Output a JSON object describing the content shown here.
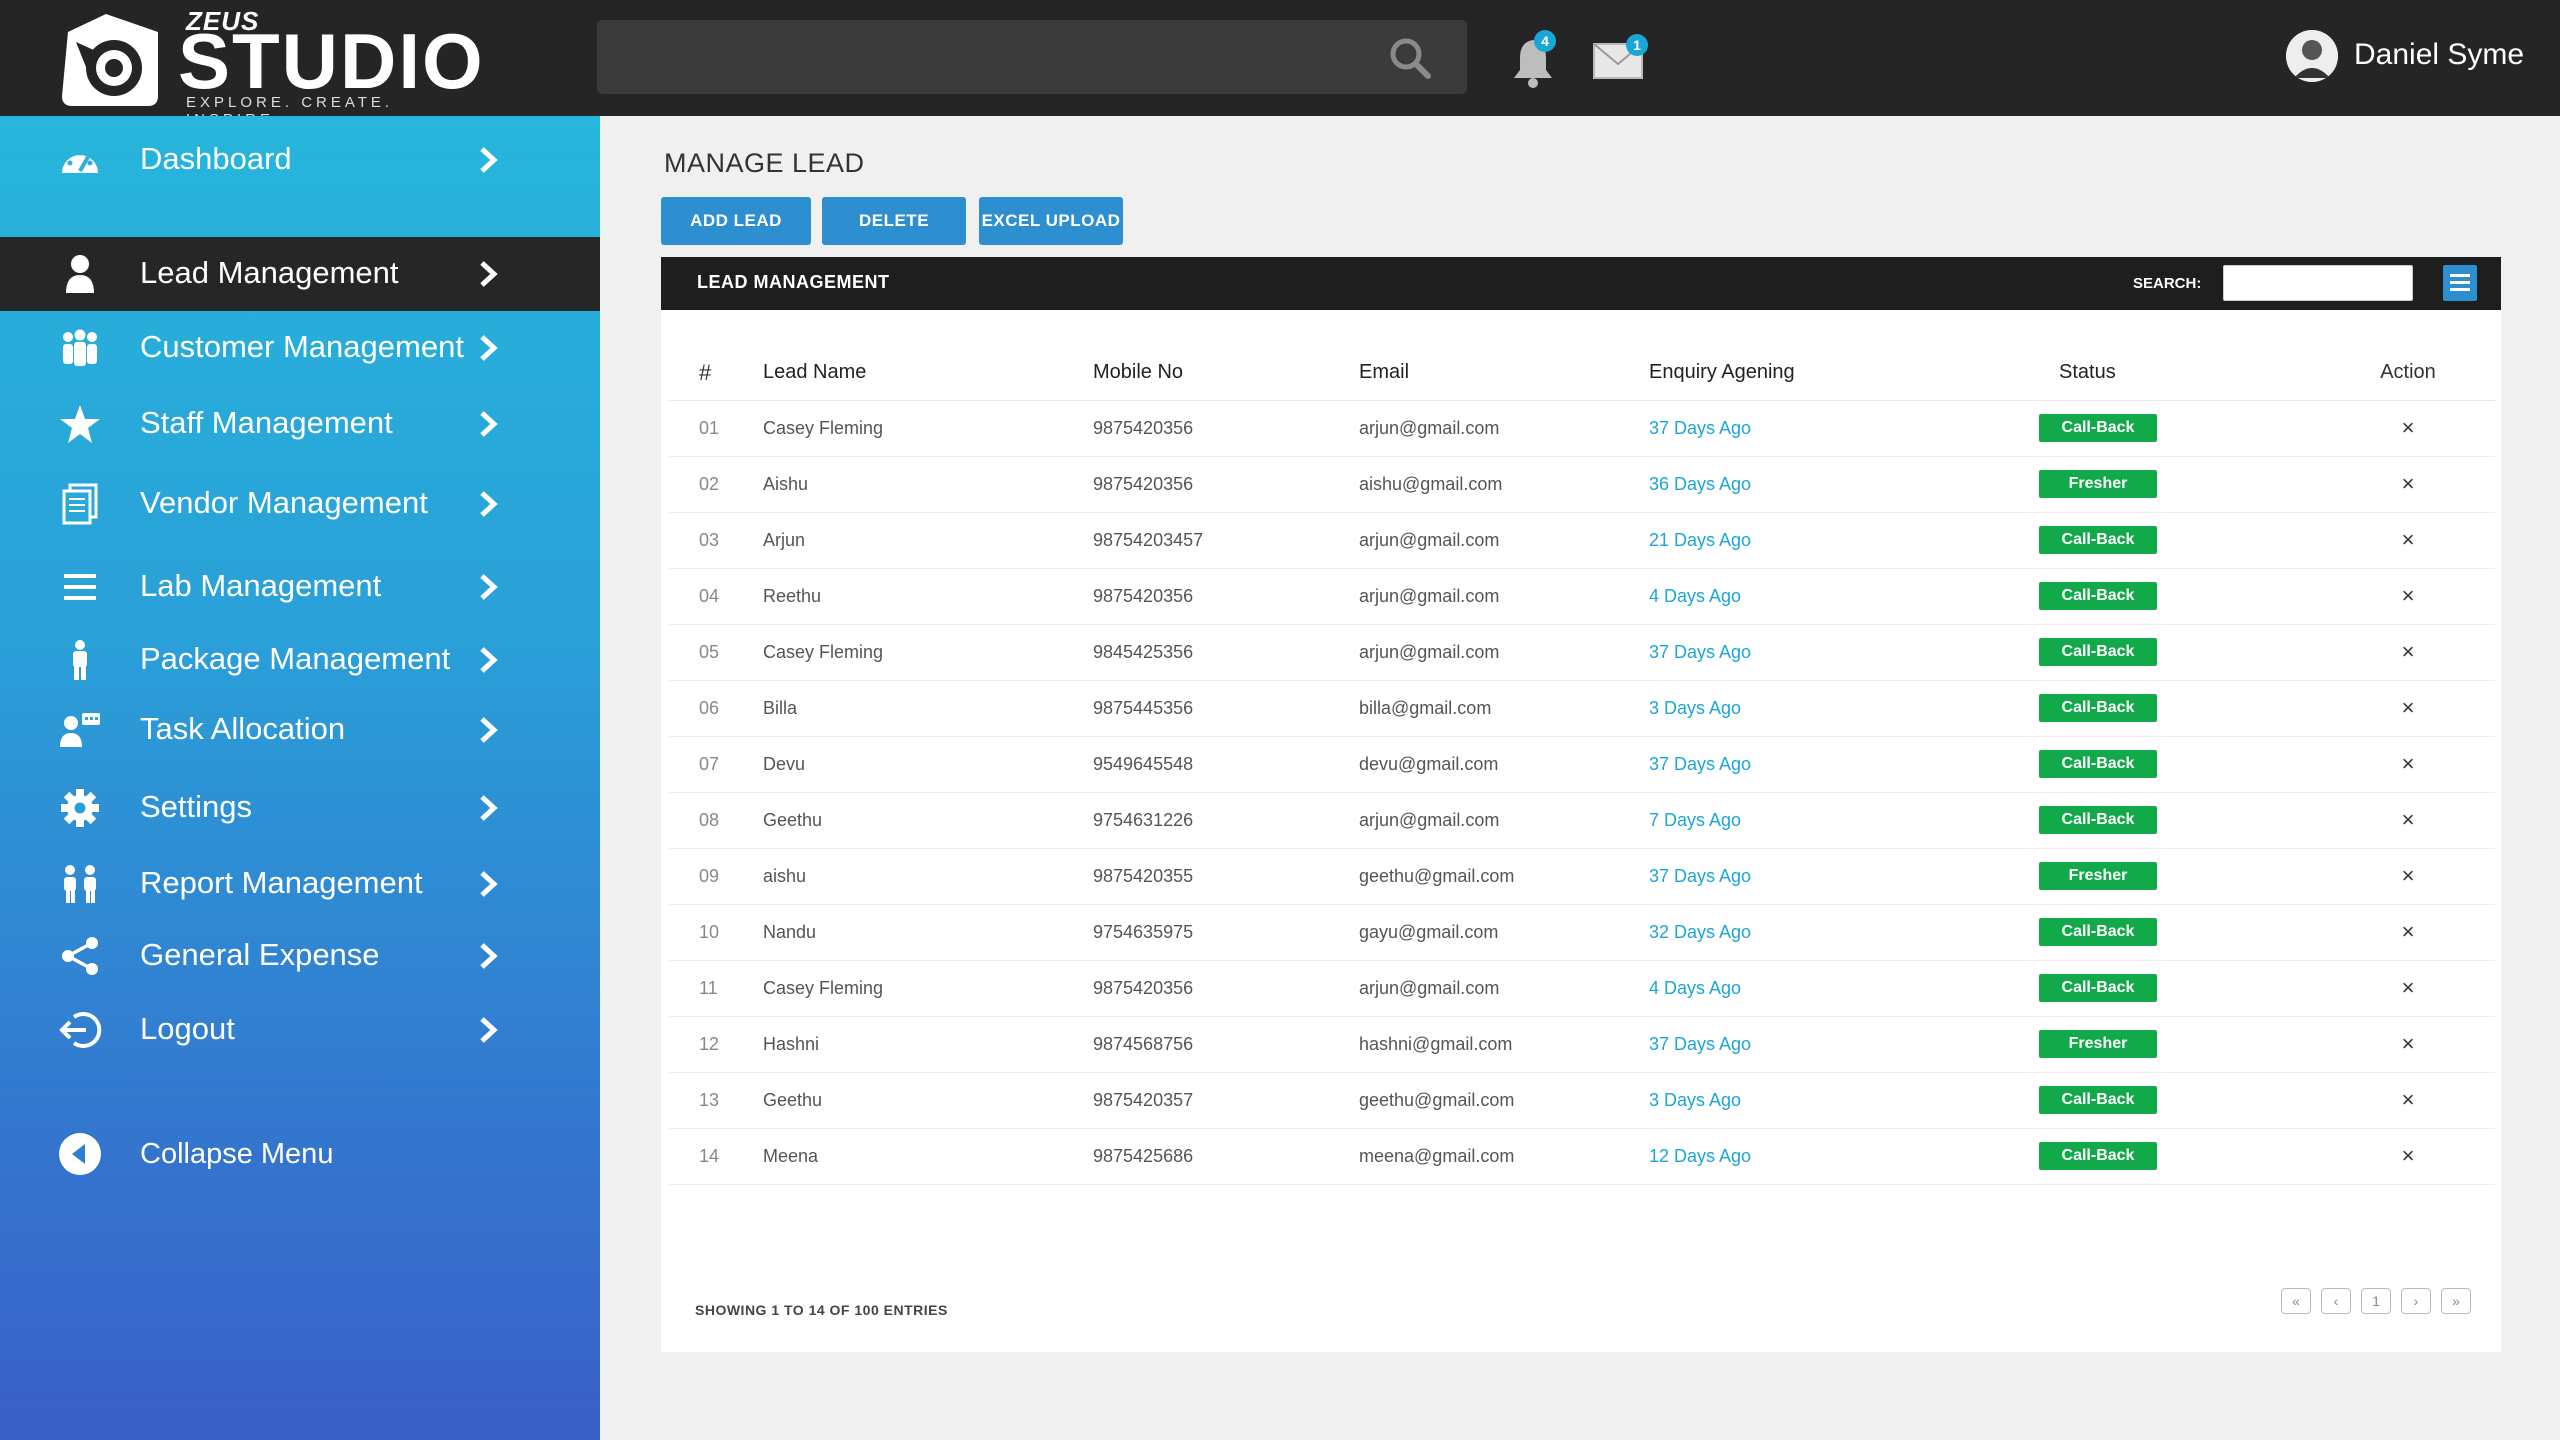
{
  "brand": {
    "small": "ZEUS",
    "name": "STUDIO",
    "tagline": "EXPLORE. CREATE. INSPIRE"
  },
  "header": {
    "search_placeholder": "",
    "notifications_count": "4",
    "messages_count": "1",
    "user_name": "Daniel Syme"
  },
  "sidebar": {
    "items": [
      {
        "label": "Dashboard",
        "icon": "dashboard-gauge-icon",
        "active": false
      },
      {
        "label": "Lead Management",
        "icon": "user-icon",
        "active": true
      },
      {
        "label": "Customer Management",
        "icon": "group-icon",
        "active": false
      },
      {
        "label": "Staff Management",
        "icon": "star-icon",
        "active": false
      },
      {
        "label": "Vendor Management",
        "icon": "documents-icon",
        "active": false
      },
      {
        "label": "Lab Management",
        "icon": "list-icon",
        "active": false
      },
      {
        "label": "Package Management",
        "icon": "person-icon",
        "active": false
      },
      {
        "label": "Task Allocation",
        "icon": "user-chat-icon",
        "active": false
      },
      {
        "label": "Settings",
        "icon": "gear-icon",
        "active": false
      },
      {
        "label": "Report Management",
        "icon": "people-icon",
        "active": false
      },
      {
        "label": "General Expense",
        "icon": "share-icon",
        "active": false
      },
      {
        "label": "Logout",
        "icon": "logout-icon",
        "active": false
      }
    ],
    "collapse_label": "Collapse Menu"
  },
  "main": {
    "title": "MANAGE LEAD",
    "buttons": {
      "add": "ADD LEAD",
      "delete": "DELETE",
      "excel": "EXCEL UPLOAD"
    },
    "panel_title": "LEAD MANAGEMENT",
    "search_label": "SEARCH:",
    "columns": [
      "#",
      "Lead Name",
      "Mobile No",
      "Email",
      "Enquiry Agening",
      "Status",
      "Action"
    ],
    "rows": [
      {
        "num": "01",
        "name": "Casey Fleming",
        "mobile": "9875420356",
        "email": "arjun@gmail.com",
        "age": "37 Days Ago",
        "status": "Call-Back",
        "action": "×"
      },
      {
        "num": "02",
        "name": "Aishu",
        "mobile": "9875420356",
        "email": "aishu@gmail.com",
        "age": "36 Days Ago",
        "status": "Fresher",
        "action": "×"
      },
      {
        "num": "03",
        "name": "Arjun",
        "mobile": "98754203457",
        "email": "arjun@gmail.com",
        "age": "21 Days Ago",
        "status": "Call-Back",
        "action": "×"
      },
      {
        "num": "04",
        "name": "Reethu",
        "mobile": "9875420356",
        "email": "arjun@gmail.com",
        "age": "4 Days Ago",
        "status": "Call-Back",
        "action": "×"
      },
      {
        "num": "05",
        "name": "Casey Fleming",
        "mobile": "9845425356",
        "email": "arjun@gmail.com",
        "age": "37 Days Ago",
        "status": "Call-Back",
        "action": "×"
      },
      {
        "num": "06",
        "name": "Billa",
        "mobile": "9875445356",
        "email": "billa@gmail.com",
        "age": "3  Days Ago",
        "status": "Call-Back",
        "action": "×"
      },
      {
        "num": "07",
        "name": "Devu",
        "mobile": "9549645548",
        "email": "devu@gmail.com",
        "age": "37 Days Ago",
        "status": "Call-Back",
        "action": "×"
      },
      {
        "num": "08",
        "name": "Geethu",
        "mobile": "9754631226",
        "email": "arjun@gmail.com",
        "age": "7 Days Ago",
        "status": "Call-Back",
        "action": "×"
      },
      {
        "num": "09",
        "name": "aishu",
        "mobile": "9875420355",
        "email": "geethu@gmail.com",
        "age": "37 Days Ago",
        "status": "Fresher",
        "action": "×"
      },
      {
        "num": "10",
        "name": "Nandu",
        "mobile": "9754635975",
        "email": "gayu@gmail.com",
        "age": "32 Days Ago",
        "status": "Call-Back",
        "action": "×"
      },
      {
        "num": "11",
        "name": "Casey Fleming",
        "mobile": "9875420356",
        "email": "arjun@gmail.com",
        "age": "4 Days Ago",
        "status": "Call-Back",
        "action": "×"
      },
      {
        "num": "12",
        "name": "Hashni",
        "mobile": "9874568756",
        "email": "hashni@gmail.com",
        "age": "37 Days Ago",
        "status": "Fresher",
        "action": "×"
      },
      {
        "num": "13",
        "name": "Geethu",
        "mobile": "9875420357",
        "email": "geethu@gmail.com",
        "age": "3 Days Ago",
        "status": "Call-Back",
        "action": "×"
      },
      {
        "num": "14",
        "name": "Meena",
        "mobile": "9875425686",
        "email": "meena@gmail.com",
        "age": "12 Days Ago",
        "status": "Call-Back",
        "action": "×"
      }
    ],
    "showing": "SHOWING 1 TO 14 OF 100 ENTRIES",
    "pagination": {
      "first": "«",
      "prev": "‹",
      "current": "1",
      "next": "›",
      "last": "»"
    }
  },
  "colors": {
    "topbar": "#252525",
    "sidebar_top": "#27b6dc",
    "sidebar_bottom": "#3a5fc7",
    "accent": "#2d8fd0",
    "status_green": "#12a94a",
    "link_blue": "#1aa6d6"
  }
}
